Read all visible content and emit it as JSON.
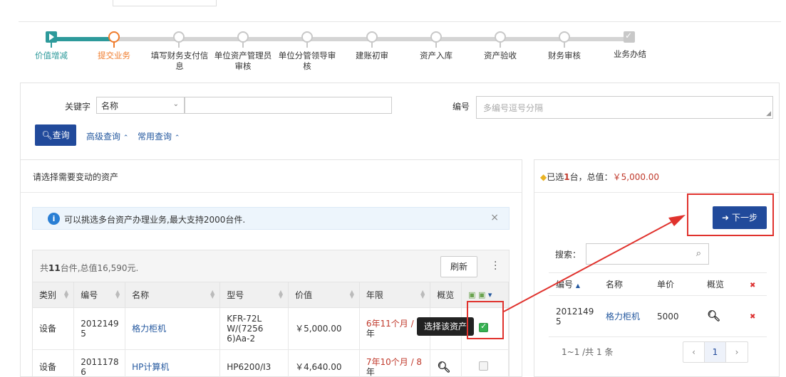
{
  "steps": [
    {
      "label": "价值增减",
      "state": "done"
    },
    {
      "label": "提交业务",
      "state": "current"
    },
    {
      "label": "填写财务支付信息",
      "state": "pending"
    },
    {
      "label": "单位资产管理员审核",
      "state": "pending"
    },
    {
      "label": "单位分管领导审核",
      "state": "pending"
    },
    {
      "label": "建账初审",
      "state": "pending"
    },
    {
      "label": "资产入库",
      "state": "pending"
    },
    {
      "label": "资产验收",
      "state": "pending"
    },
    {
      "label": "财务审核",
      "state": "pending"
    },
    {
      "label": "业务办结",
      "state": "final"
    }
  ],
  "search": {
    "keyword_label": "关键字",
    "keyword_select": "名称",
    "keyword_value": "",
    "number_label": "编号",
    "number_placeholder": "多编号逗号分隔",
    "query_button": "查询",
    "advanced_link": "高级查询",
    "common_link": "常用查询"
  },
  "left_panel": {
    "title": "请选择需要变动的资产",
    "alert": "可以挑选多台资产办理业务,最大支持2000台件.",
    "summary_prefix": "共",
    "summary_count": "11",
    "summary_suffix": "台件,总值16,590元.",
    "refresh_button": "刷新",
    "columns": [
      "类别",
      "编号",
      "名称",
      "型号",
      "价值",
      "年限",
      "概览"
    ],
    "rows": [
      {
        "category": "设备",
        "code_a": "2012149",
        "code_b": "5",
        "name": "格力柜机",
        "model_a": "KFR-72L",
        "model_b": "W/(7256",
        "model_c": "6)Aa-2",
        "value": "￥5,000.00",
        "life_a": "6年11个月 / 8",
        "life_b": "年",
        "checked": true
      },
      {
        "category": "设备",
        "code_a": "2011178",
        "code_b": "6",
        "name": "HP计算机",
        "model_a": "HP6200/I3",
        "model_b": "",
        "model_c": "",
        "value": "￥4,640.00",
        "life_a": "7年10个月 / 8",
        "life_b": "年",
        "checked": false
      }
    ],
    "tooltip": "选择该资产"
  },
  "right_panel": {
    "head_prefix": "已选",
    "head_count": "1",
    "head_middle": "台，总值：",
    "head_money": "￥5,000.00",
    "next_button": "下一步",
    "search_label": "搜索：",
    "columns": [
      "编号",
      "名称",
      "单价",
      "概览"
    ],
    "rows": [
      {
        "code_a": "2012149",
        "code_b": "5",
        "name": "格力柜机",
        "price": "5000"
      }
    ],
    "pager_text": "1~1 /共 1 条",
    "pager": {
      "prev": "‹",
      "page": "1",
      "next": "›"
    }
  },
  "colors": {
    "done": "#2d9a9b",
    "current": "#f07c2c",
    "primary": "#214a9b",
    "highlight": "#e0322d"
  }
}
